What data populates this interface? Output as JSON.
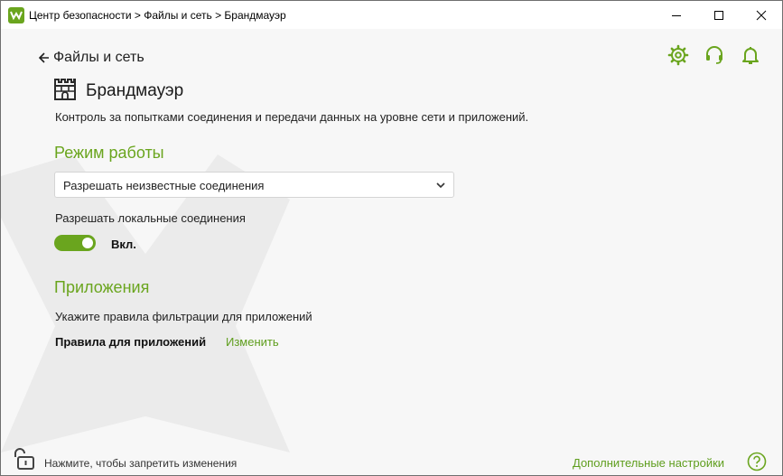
{
  "window": {
    "title": "Центр безопасности > Файлы и сеть > Брандмауэр",
    "controls": {
      "minimize_icon": "minimize-icon",
      "maximize_icon": "maximize-icon",
      "close_icon": "close-icon"
    }
  },
  "header": {
    "back_label": "Файлы и сеть",
    "icons": [
      "gear-icon",
      "headset-icon",
      "bell-icon"
    ]
  },
  "page": {
    "title": "Брандмауэр",
    "icon": "firewall-tower-icon",
    "description": "Контроль за попытками соединения и передачи данных на уровне сети и приложений."
  },
  "mode_section": {
    "title": "Режим работы",
    "dropdown_value": "Разрешать неизвестные соединения",
    "local_connections_label": "Разрешать локальные соединения",
    "toggle_state_label": "Вкл.",
    "toggle_on": true
  },
  "apps_section": {
    "title": "Приложения",
    "hint": "Укажите правила фильтрации для приложений",
    "rules_label": "Правила для приложений",
    "rules_link": "Изменить"
  },
  "footer": {
    "lock_text": "Нажмите, чтобы запретить изменения",
    "advanced_link": "Дополнительные настройки",
    "help_icon": "help-icon"
  },
  "colors": {
    "accent": "#6aa51e",
    "link": "#5f9e1e",
    "background": "#f7f7f7"
  }
}
